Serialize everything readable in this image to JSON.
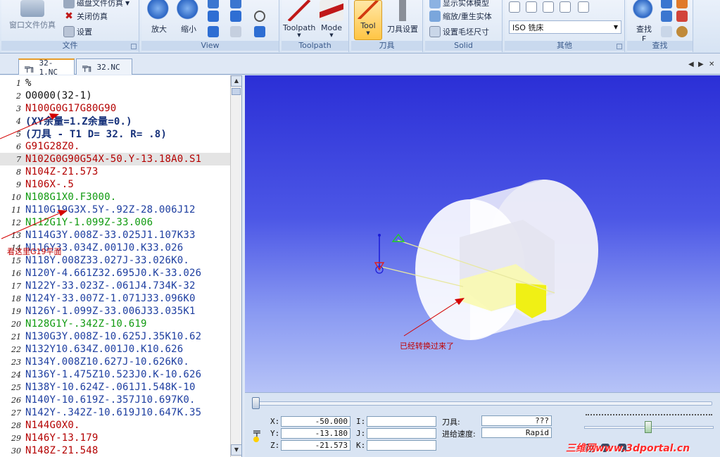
{
  "ribbon": {
    "file": {
      "label": "文件",
      "sim_window": "窗口文件仿真",
      "disk_sim": "磁盘文件仿真",
      "close_sim": "关闭仿真",
      "settings": "设置"
    },
    "view": {
      "label": "View",
      "zoom_in": "放大",
      "zoom_out": "缩小"
    },
    "toolpath": {
      "label": "Toolpath",
      "toolpath_btn": "Toolpath",
      "mode_btn": "Mode"
    },
    "tool": {
      "label": "刀具",
      "tool_btn": "Tool",
      "tool_settings": "刀具设置"
    },
    "solid": {
      "label": "Solid",
      "show_solid": "显示实体模型",
      "zoom_regen": "缩放/重生实体",
      "stock_size": "设置毛坯尺寸"
    },
    "other": {
      "label": "其他",
      "machine_select": "ISO 铣床"
    },
    "find": {
      "label": "查找",
      "find_btn": "查找",
      "find_key": "F"
    }
  },
  "tabs": [
    {
      "label": "32-1.NC",
      "active": true
    },
    {
      "label": "32.NC",
      "active": false
    }
  ],
  "code_lines": [
    {
      "n": "1",
      "text": "%",
      "color": "dark"
    },
    {
      "n": "2",
      "text": "O0000(32-1)",
      "color": "dark"
    },
    {
      "n": "3",
      "text": "N100G0G17G80G90",
      "color": "red"
    },
    {
      "n": "4",
      "text": "(XY余量=1.Z余量=0.)",
      "color": "navy"
    },
    {
      "n": "5",
      "text": "(刀具 - T1 D= 32. R= .8)",
      "color": "navy"
    },
    {
      "n": "6",
      "text": "G91G28Z0.",
      "color": "red"
    },
    {
      "n": "7",
      "text": "N102G0G90G54X-50.Y-13.18A0.S1",
      "color": "red"
    },
    {
      "n": "8",
      "text": "N104Z-21.573",
      "color": "red"
    },
    {
      "n": "9",
      "text": "N106X-.5",
      "color": "red"
    },
    {
      "n": "10",
      "text": "N108G1X0.F3000.",
      "color": "green"
    },
    {
      "n": "11",
      "text": "N110G19G3X.5Y-.92Z-28.006J12",
      "color": "blue"
    },
    {
      "n": "12",
      "text": "N112G1Y-1.099Z-33.006",
      "color": "green"
    },
    {
      "n": "13",
      "text": "N114G3Y.008Z-33.025J1.107K33",
      "color": "blue"
    },
    {
      "n": "14",
      "text": "N116Y33.034Z.001J0.K33.026",
      "color": "blue"
    },
    {
      "n": "15",
      "text": "N118Y.008Z33.027J-33.026K0.",
      "color": "blue"
    },
    {
      "n": "16",
      "text": "N120Y-4.661Z32.695J0.K-33.026",
      "color": "blue"
    },
    {
      "n": "17",
      "text": "N122Y-33.023Z-.061J4.734K-32",
      "color": "blue"
    },
    {
      "n": "18",
      "text": "N124Y-33.007Z-1.071J33.096K0",
      "color": "blue"
    },
    {
      "n": "19",
      "text": "N126Y-1.099Z-33.006J33.035K1",
      "color": "blue"
    },
    {
      "n": "20",
      "text": "N128G1Y-.342Z-10.619",
      "color": "green"
    },
    {
      "n": "21",
      "text": "N130G3Y.008Z-10.625J.35K10.62",
      "color": "blue"
    },
    {
      "n": "22",
      "text": "N132Y10.634Z.001J0.K10.626",
      "color": "blue"
    },
    {
      "n": "23",
      "text": "N134Y.008Z10.627J-10.626K0.",
      "color": "blue"
    },
    {
      "n": "24",
      "text": "N136Y-1.475Z10.523J0.K-10.626",
      "color": "blue"
    },
    {
      "n": "25",
      "text": "N138Y-10.624Z-.061J1.548K-10",
      "color": "blue"
    },
    {
      "n": "26",
      "text": "N140Y-10.619Z-.357J10.697K0.",
      "color": "blue"
    },
    {
      "n": "27",
      "text": "N142Y-.342Z-10.619J10.647K.35",
      "color": "blue"
    },
    {
      "n": "28",
      "text": "N144G0X0.",
      "color": "red"
    },
    {
      "n": "29",
      "text": "N146Y-13.179",
      "color": "red"
    },
    {
      "n": "30",
      "text": "N148Z-21.548",
      "color": "red"
    }
  ],
  "annotations": {
    "yz_plane": "看这里G19平面",
    "converted": "已经转换过来了"
  },
  "control": {
    "coords": {
      "x_label": "X:",
      "x_value": "-50.000",
      "y_label": "Y:",
      "y_value": "-13.180",
      "z_label": "Z:",
      "z_value": "-21.573",
      "i_label": "I:",
      "i_value": "",
      "j_label": "J:",
      "j_value": "",
      "k_label": "K:",
      "k_value": ""
    },
    "tool_label": "刀具:",
    "tool_value": "???",
    "feed_label": "进给速度:",
    "feed_value": "Rapid"
  },
  "watermark": "三维网www.3dportal.cn",
  "colors": {
    "accent": "#e79c2a",
    "code_red": "#b40000",
    "code_blue": "#1d3ea0",
    "code_green": "#109a10",
    "viewport_top": "#2b2fd6",
    "viewport_bottom": "#b6c3f7"
  }
}
